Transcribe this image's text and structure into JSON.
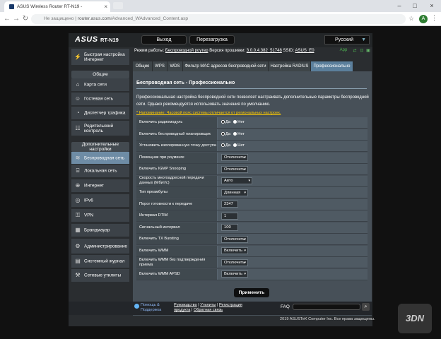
{
  "browser": {
    "tab_title": "ASUS Wireless Router RT-N19 - ",
    "url_prefix": "Не защищено",
    "url_separator": "|",
    "url_host": "router.asus.com",
    "url_path": "/Advanced_WAdvanced_Content.asp",
    "profile_letter": "A"
  },
  "header": {
    "logo": "ASUS",
    "model": "RT-N19",
    "logout_label": "Выход",
    "reboot_label": "Перезагрузка",
    "language": "Русский"
  },
  "status": {
    "mode_label": "Режим работы:",
    "mode_value": "Беспроводной роутер",
    "fw_label": "Версия прошивки:",
    "fw_value": "3.0.0.4.382_51748",
    "ssid_label": "SSID:",
    "ssid_value": "ASUS_E0",
    "app_label": "App"
  },
  "sidebar": {
    "quick_setup": "Быстрая настройка Интернет",
    "general_header": "Общие",
    "general_items": [
      {
        "label": "Карта сети",
        "icon": "network-map-icon"
      },
      {
        "label": "Гостевая сеть",
        "icon": "guest-network-icon"
      },
      {
        "label": "Диспетчер трафика",
        "icon": "traffic-manager-icon"
      },
      {
        "label": "Родительский контроль",
        "icon": "parental-control-icon"
      }
    ],
    "advanced_header": "Дополнительные настройки",
    "advanced_items": [
      {
        "label": "Беспроводная сеть",
        "icon": "wireless-icon",
        "active": true
      },
      {
        "label": "Локальная сеть",
        "icon": "lan-icon"
      },
      {
        "label": "Интернет",
        "icon": "internet-icon"
      },
      {
        "label": "IPv6",
        "icon": "ipv6-icon"
      },
      {
        "label": "VPN",
        "icon": "vpn-icon"
      },
      {
        "label": "Брандмауэр",
        "icon": "firewall-icon"
      },
      {
        "label": "Администрирование",
        "icon": "administration-icon"
      },
      {
        "label": "Системный журнал",
        "icon": "system-log-icon"
      },
      {
        "label": "Сетевые утилиты",
        "icon": "network-tools-icon"
      }
    ]
  },
  "tabs": [
    "Общие",
    "WPS",
    "WDS",
    "Фильтр MAC адресов беспроводной сети",
    "Настройка RADIUS",
    "Профессионально"
  ],
  "content": {
    "title": "Беспроводная сеть - Профессионально",
    "description": "Профессиональная настройка беспроводной сети позволяет настраивать дополнительные параметры беспроводной сети. Однако рекомендуется использовать значения по умолчанию.",
    "note": "* Напоминание: Часовой пояс системы отличается от региональных настроек.",
    "radio_yes": "Да",
    "radio_no": "Нет",
    "rows": [
      {
        "label": "Включить радиомодуль",
        "type": "radio",
        "value": "Да"
      },
      {
        "label": "Включить беспроводный планировщик",
        "type": "radio",
        "value": "Да"
      },
      {
        "label": "Установить изолированную точку доступа",
        "type": "radio",
        "value": "Да"
      },
      {
        "label": "Помощник при роуминге",
        "type": "select",
        "value": "Отключить"
      },
      {
        "label": "Включить IGMP Snooping",
        "type": "select",
        "value": "Отключить"
      },
      {
        "label": "Скорость многоадресной передачи данных (Мбит/с)",
        "type": "select",
        "value": "Авто"
      },
      {
        "label": "Тип преамбулы",
        "type": "select",
        "value": "Длинная"
      },
      {
        "label": "Порог готовности к передаче",
        "type": "input",
        "value": "2347"
      },
      {
        "label": "Интервал DTIM",
        "type": "input",
        "value": "1"
      },
      {
        "label": "Сигнальный интервал",
        "type": "input",
        "value": "100"
      },
      {
        "label": "Включить TX Bursting",
        "type": "select",
        "value": "Отключить"
      },
      {
        "label": "Включить WMM",
        "type": "select",
        "value": "Включить"
      },
      {
        "label": "Включить WMM без подтверждения приема",
        "type": "select",
        "value": "Отключить"
      },
      {
        "label": "Включить WMM APSD",
        "type": "select",
        "value": "Включить"
      }
    ],
    "apply_label": "Применить"
  },
  "footer": {
    "help_line1": "Помощь &",
    "help_line2": "Поддержка",
    "link_manual": "Руководство",
    "link_utils": "Утилиты",
    "link_reg": "Регистрация",
    "link_product": "продукта",
    "link_feedback": "Обратная связь",
    "faq": "FAQ",
    "copyright": "2019 ASUSTeK Computer Inc. Все права защищены."
  },
  "watermark": "3DN",
  "colors": {
    "active_tab": "#5b7f9c",
    "active_sidebar": "#6e8ca5",
    "note": "#ffcc00"
  }
}
